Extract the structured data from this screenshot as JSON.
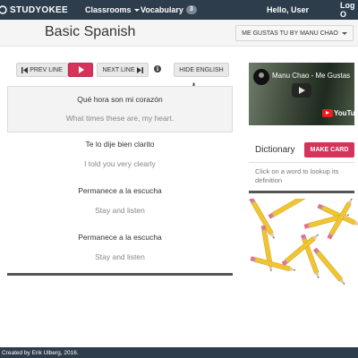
{
  "navbar": {
    "brand": "STUDYOKEE",
    "classrooms": "Classrooms",
    "vocabulary": "Vocabulary",
    "vocab_count": "3",
    "user": "Hello, User",
    "logout": "Log O"
  },
  "header": {
    "title": "Basic Spanish",
    "song": "ME GUSTAS TU BY MANU CHAO"
  },
  "controls": {
    "prev": "PREV LINE",
    "next": "NEXT LINE",
    "hide": "HIDE ENGLISH",
    "info": "i"
  },
  "lyrics": [
    {
      "es": "Qué hora son mi corazón",
      "en": "What times these are, my heart."
    },
    {
      "es": "Te lo dije bien clarito",
      "en": "I told you very clearly"
    },
    {
      "es": "Permanece a la escucha",
      "en": "Stay and listen"
    },
    {
      "es": "Permanece a la escucha",
      "en": "Stay and listen"
    }
  ],
  "video": {
    "title": "Manu Chao - Me Gustas",
    "logo": "YouTube"
  },
  "dictionary": {
    "label": "Dictionary",
    "make_card": "MAKE CARD",
    "help": "Click on a word to lookup its definition"
  },
  "footer": {
    "text": "Created by Erik Ulberg, 2016."
  },
  "colors": {
    "navbar": "#2e3d4c",
    "accent": "#d6335a"
  }
}
